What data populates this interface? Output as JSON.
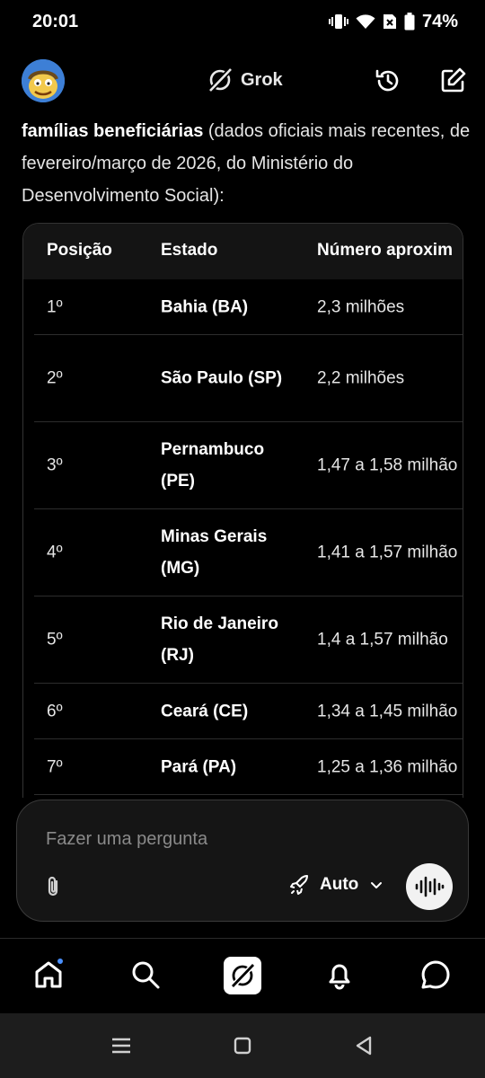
{
  "status": {
    "time": "20:01",
    "battery": "74%"
  },
  "header": {
    "brand": "Grok",
    "avatar_icon": "avatar-cartoon-icon"
  },
  "intro": {
    "bold": "famílias beneficiárias",
    "rest": " (dados oficiais mais recentes, de fevereiro/março de 2026, do Ministério do Desenvolvimento Social):"
  },
  "table": {
    "headers": [
      "Posição",
      "Estado",
      "Número aproxim"
    ],
    "rows": [
      {
        "pos": "1º",
        "state": "Bahia (BA)",
        "num": "2,3 milhões"
      },
      {
        "pos": "2º",
        "state": "São Paulo (SP)",
        "num": "2,2 milhões"
      },
      {
        "pos": "3º",
        "state": "Pernambuco (PE)",
        "num": "1,47 a 1,58 milhão"
      },
      {
        "pos": "4º",
        "state": "Minas Gerais (MG)",
        "num": "1,41 a 1,57 milhão"
      },
      {
        "pos": "5º",
        "state": "Rio de Janeiro (RJ)",
        "num": "1,4 a 1,57 milhão"
      },
      {
        "pos": "6º",
        "state": "Ceará (CE)",
        "num": "1,34 a 1,45 milhão"
      },
      {
        "pos": "7º",
        "state": "Pará (PA)",
        "num": "1,25 a 1,36 milhão"
      }
    ]
  },
  "composer": {
    "placeholder": "Fazer uma pergunta",
    "mode": "Auto"
  },
  "colors": {
    "background": "#000000",
    "notification_dot": "#4a90ff"
  }
}
